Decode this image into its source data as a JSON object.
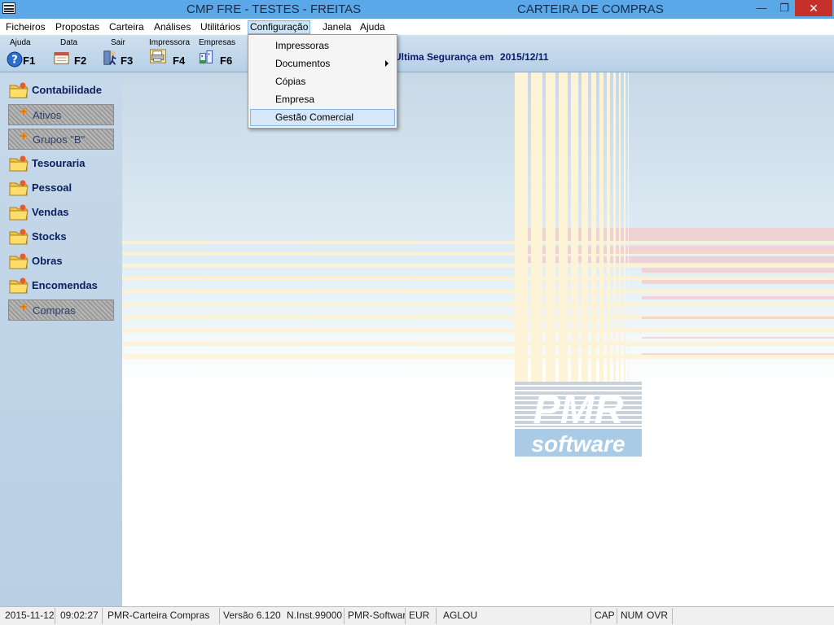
{
  "window": {
    "title": "CMP FRE - TESTES - FREITAS",
    "subtitle": "CARTEIRA DE COMPRAS",
    "minimize_label": "—",
    "maximize_label": "❐",
    "close_label": "✕"
  },
  "menubar": {
    "items": [
      "Ficheiros",
      "Propostas",
      "Carteira",
      "Análises",
      "Utilitários",
      "Configuração",
      "Janela",
      "Ajuda"
    ],
    "active": "Configuração"
  },
  "toolbar": {
    "tools": [
      {
        "label": "Ajuda",
        "key": "F1",
        "icon": "help-icon"
      },
      {
        "label": "Data",
        "key": "F2",
        "icon": "calendar-icon"
      },
      {
        "label": "Sair",
        "key": "F3",
        "icon": "exit-person-icon"
      },
      {
        "label": "Impressora",
        "key": "F4",
        "icon": "printer-icon"
      },
      {
        "label": "Empresas",
        "key": "F6",
        "icon": "companies-icon"
      }
    ],
    "safety_label": "Ultima Segurança em",
    "safety_date": "2015/12/11"
  },
  "dropdown": {
    "items": [
      "Impressoras",
      "Documentos",
      "Cópias",
      "Empresa",
      "Gestão Comercial"
    ],
    "highlighted": "Gestão Comercial"
  },
  "sidebar": {
    "items": [
      {
        "label": "Contabilidade",
        "enabled": true
      },
      {
        "label": "Ativos",
        "enabled": false
      },
      {
        "label": "Grupos \"B\"",
        "enabled": false
      },
      {
        "label": "Tesouraria",
        "enabled": true
      },
      {
        "label": "Pessoal",
        "enabled": true
      },
      {
        "label": "Vendas",
        "enabled": true
      },
      {
        "label": "Stocks",
        "enabled": true
      },
      {
        "label": "Obras",
        "enabled": true
      },
      {
        "label": "Encomendas",
        "enabled": true
      },
      {
        "label": "Compras",
        "enabled": false
      }
    ]
  },
  "logo": {
    "brand": "PMR",
    "word": "software"
  },
  "statusbar": {
    "date": "2015-11-12",
    "time": "09:02:27",
    "app": "PMR-Carteira Compras",
    "version_label": "Versão",
    "version": "6.120",
    "install": "N.Inst.99000",
    "company": "PMR-Software",
    "currency": "EUR",
    "user": "AGLOU",
    "cap": "CAP",
    "num": "NUM",
    "ovr": "OVR"
  },
  "colors": {
    "titlebar": "#5aa8e8",
    "sidebar": "#c6d9ea",
    "accent_text": "#0c2060",
    "close_button": "#c7302a"
  }
}
